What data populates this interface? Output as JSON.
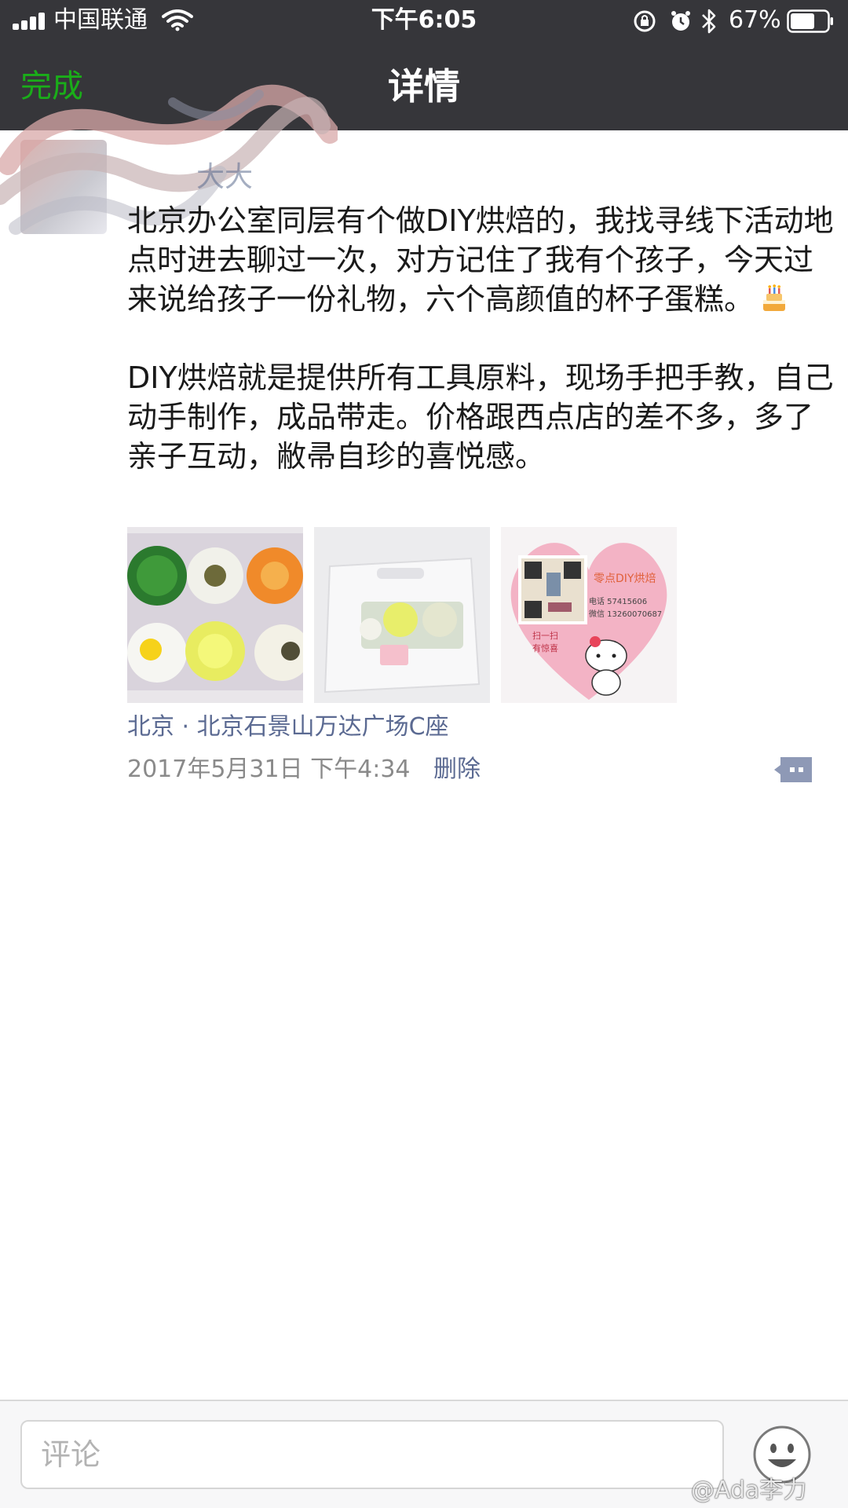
{
  "status_bar": {
    "carrier": "中国联通",
    "time": "下午6:05",
    "battery": "67%",
    "battery_level": 0.67,
    "icons": [
      "signal-icon",
      "wifi-icon",
      "orientation-lock-icon",
      "alarm-icon",
      "bluetooth-icon",
      "battery-icon"
    ]
  },
  "nav": {
    "done_label": "完成",
    "title": "详情"
  },
  "post": {
    "author": "大大",
    "paragraph1": "北京办公室同层有个做DIY烘焙的，我找寻线下活动地点时进去聊过一次，对方记住了我有个孩子，今天过来说给孩子一份礼物，六个高颜值的杯子蛋糕。",
    "emoji": "birthday-cake-icon",
    "paragraph2": "DIY烘焙就是提供所有工具原料，现场手把手教，自己动手制作，成品带走。价格跟西点店的差不多，多了亲子互动，敝帚自珍的喜悦感。",
    "photos": [
      "cupcakes-photo",
      "cake-box-photo",
      "heart-card-photo"
    ],
    "photo_card_text": {
      "shop": "零点DIY烘焙",
      "phone": "电话 57415606",
      "wechat": "微信 13260070687",
      "scan": "扫一扫",
      "surprise": "有惊喜"
    },
    "location": "北京 · 北京石景山万达广场C座",
    "timestamp": "2017年5月31日 下午4:34",
    "delete_label": "删除"
  },
  "comment_bar": {
    "placeholder": "评论"
  },
  "watermark": "@Ada李力",
  "colors": {
    "nav_bg": "#36363a",
    "accent_green": "#1aad19",
    "link_blue": "#5b6a92",
    "meta_gray": "#8a8a8a"
  }
}
